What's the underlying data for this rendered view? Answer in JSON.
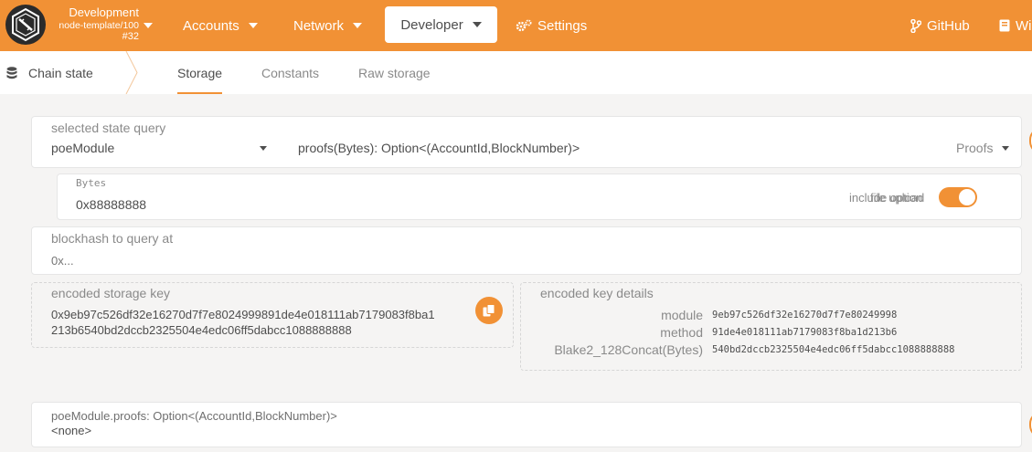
{
  "topbar": {
    "chain_name": "Development",
    "chain_runtime": "node-template/100",
    "block_number": "#32",
    "nav": {
      "accounts": "Accounts",
      "network": "Network",
      "developer": "Developer",
      "settings": "Settings",
      "github": "GitHub",
      "wiki": "Wi"
    }
  },
  "subnav": {
    "title": "Chain state",
    "tabs": [
      "Storage",
      "Constants",
      "Raw storage"
    ],
    "active_tab": "Storage"
  },
  "query": {
    "label": "selected state query",
    "module": "poeModule",
    "method_signature": "proofs(Bytes): Option<(AccountId,BlockNumber)>",
    "method_docs": "Proofs"
  },
  "param": {
    "label": "Bytes",
    "value": "0x88888888",
    "include_option_label": "include option",
    "file_upload_label": "file upload",
    "toggle_on": true
  },
  "blockhash": {
    "label": "blockhash to query at",
    "placeholder": "0x..."
  },
  "encoded_key": {
    "label": "encoded storage key",
    "line1": "0x9eb97c526df32e16270d7f7e8024999891de4e018111ab7179083f8ba1",
    "line2": "213b6540bd2dccb2325504e4edc06ff5dabcc1088888888"
  },
  "key_details": {
    "label": "encoded key details",
    "rows": [
      {
        "key": "module",
        "value": "9eb97c526df32e16270d7f7e80249998"
      },
      {
        "key": "method",
        "value": "91de4e018111ab7179083f8ba1d213b6"
      },
      {
        "key": "Blake2_128Concat(Bytes)",
        "value": "540bd2dccb2325504e4edc06ff5dabcc1088888888"
      }
    ]
  },
  "result": {
    "label": "poeModule.proofs: Option<(AccountId,BlockNumber)>",
    "value": "<none>"
  },
  "colors": {
    "accent": "#f19135",
    "background": "#f5f4f3",
    "text": "#4e4e4e",
    "muted": "#8a8a8a"
  }
}
